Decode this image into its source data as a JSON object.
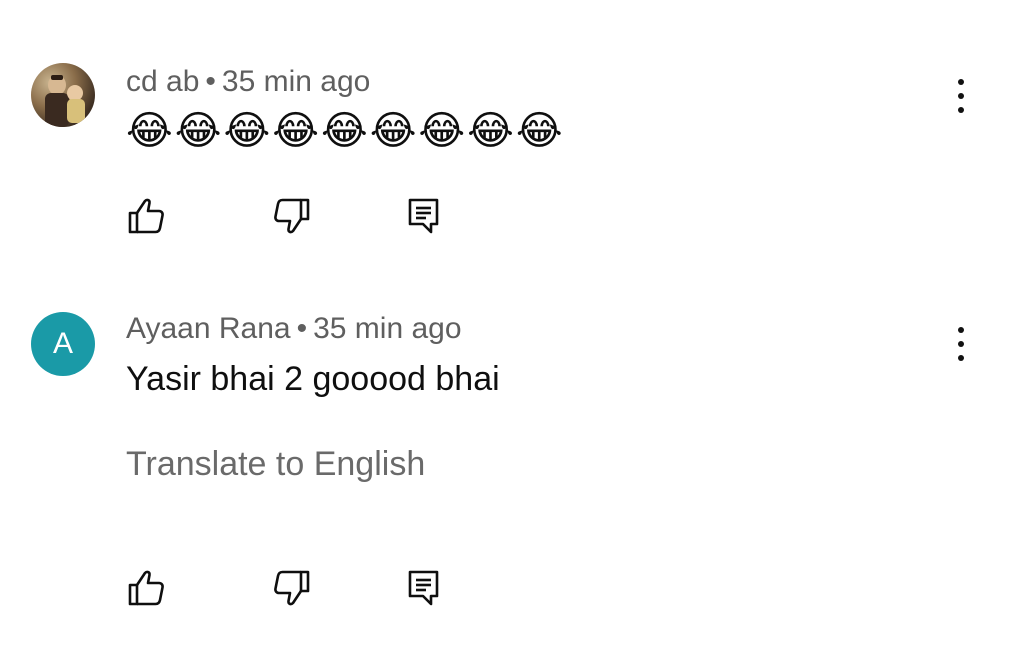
{
  "comments": [
    {
      "author": "cd ab",
      "separator": "•",
      "time": "35 min ago",
      "text": "😂😂😂😂😂😂😂😂😂",
      "avatar": {
        "type": "photo"
      },
      "actions": {
        "like_icon": "thumbs-up-icon",
        "dislike_icon": "thumbs-down-icon",
        "reply_icon": "reply-icon",
        "menu_icon": "more-vert-icon"
      }
    },
    {
      "author": "Ayaan Rana",
      "separator": "•",
      "time": "35 min ago",
      "text": "Yasir bhai 2 gooood bhai",
      "translate_label": "Translate to English",
      "avatar": {
        "type": "letter",
        "letter": "A",
        "color": "#1a9aa7"
      },
      "actions": {
        "like_icon": "thumbs-up-icon",
        "dislike_icon": "thumbs-down-icon",
        "reply_icon": "reply-icon",
        "menu_icon": "more-vert-icon"
      }
    }
  ]
}
